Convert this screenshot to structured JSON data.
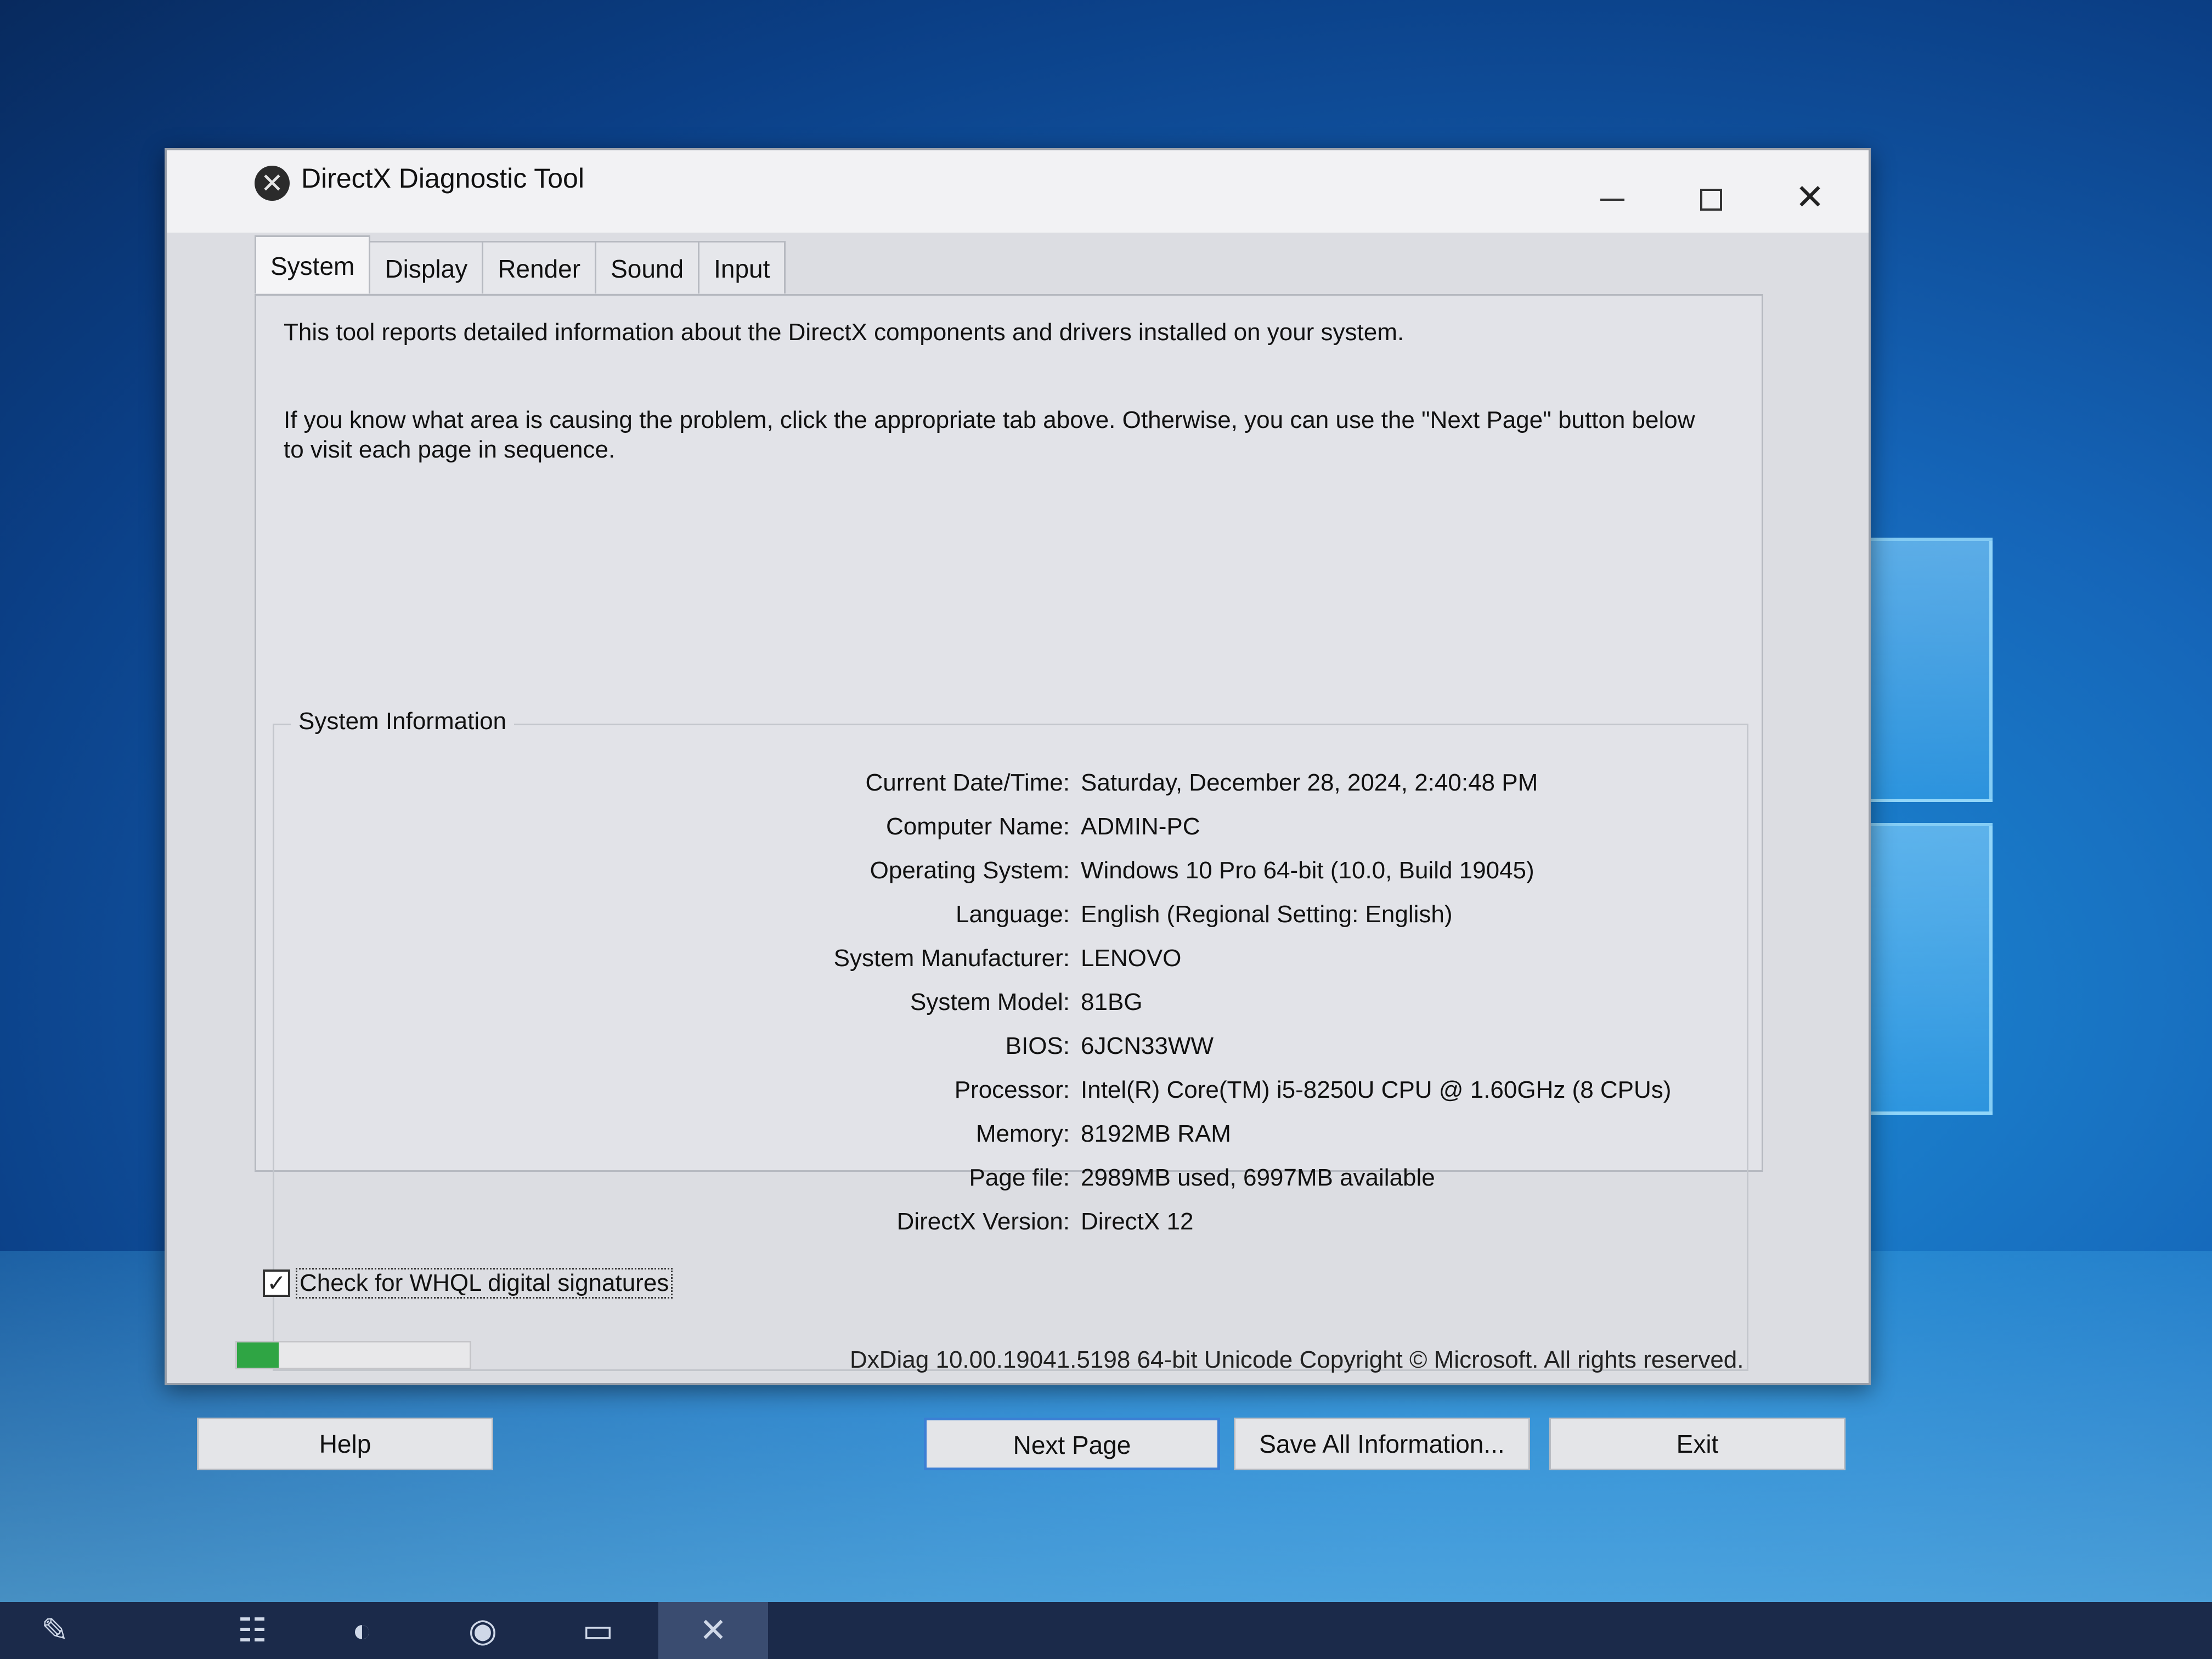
{
  "window": {
    "title": "DirectX Diagnostic Tool",
    "icon": "directx-icon"
  },
  "tabs": [
    {
      "label": "System",
      "active": true
    },
    {
      "label": "Display",
      "active": false
    },
    {
      "label": "Render",
      "active": false
    },
    {
      "label": "Sound",
      "active": false
    },
    {
      "label": "Input",
      "active": false
    }
  ],
  "intro": {
    "p1": "This tool reports detailed information about the DirectX components and drivers installed on your system.",
    "p2": "If you know what area is causing the problem, click the appropriate tab above.  Otherwise, you can use the \"Next Page\" button below to visit each page in sequence."
  },
  "system_info": {
    "title": "System Information",
    "rows": [
      {
        "label": "Current Date/Time:",
        "value": "Saturday, December 28, 2024, 2:40:48 PM"
      },
      {
        "label": "Computer Name:",
        "value": "ADMIN-PC"
      },
      {
        "label": "Operating System:",
        "value": "Windows 10 Pro 64-bit (10.0, Build 19045)"
      },
      {
        "label": "Language:",
        "value": "English (Regional Setting: English)"
      },
      {
        "label": "System Manufacturer:",
        "value": "LENOVO"
      },
      {
        "label": "System Model:",
        "value": "81BG"
      },
      {
        "label": "BIOS:",
        "value": "6JCN33WW"
      },
      {
        "label": "Processor:",
        "value": "Intel(R) Core(TM) i5-8250U CPU @ 1.60GHz (8 CPUs)"
      },
      {
        "label": "Memory:",
        "value": "8192MB RAM"
      },
      {
        "label": "Page file:",
        "value": "2989MB used, 6997MB available"
      },
      {
        "label": "DirectX Version:",
        "value": "DirectX 12"
      }
    ]
  },
  "whql": {
    "label": "Check for WHQL digital signatures",
    "checked": true
  },
  "progress": {
    "fraction": 0.18
  },
  "copyright": "DxDiag 10.00.19041.5198 64-bit Unicode  Copyright © Microsoft. All rights reserved.",
  "buttons": {
    "help": "Help",
    "next": "Next Page",
    "save": "Save All Information...",
    "exit": "Exit"
  },
  "colors": {
    "progress_fill": "#2fa544",
    "focus_border": "#3b7fd4"
  }
}
